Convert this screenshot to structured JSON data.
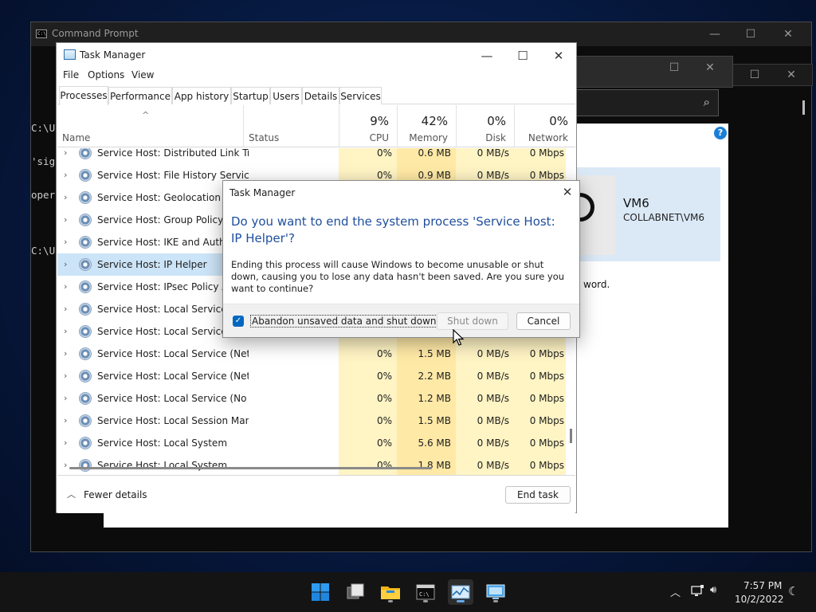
{
  "cmd": {
    "title": "Command Prompt",
    "lines": [
      "C:\\U",
      "'sig",
      "oper",
      "",
      "C:\\U"
    ]
  },
  "settings": {
    "user_name": "VM6",
    "user_account": "COLLABNET\\VM6",
    "text_fragment": "word."
  },
  "task_manager": {
    "title": "Task Manager",
    "menu": [
      "File",
      "Options",
      "View"
    ],
    "tabs": [
      "Processes",
      "Performance",
      "App history",
      "Startup",
      "Users",
      "Details",
      "Services"
    ],
    "columns": {
      "name": "Name",
      "status": "Status",
      "cpu": {
        "pct": "9%",
        "label": "CPU"
      },
      "memory": {
        "pct": "42%",
        "label": "Memory"
      },
      "disk": {
        "pct": "0%",
        "label": "Disk"
      },
      "network": {
        "pct": "0%",
        "label": "Network"
      }
    },
    "rows": [
      {
        "name": "Service Host: Distributed Link Tr...",
        "cpu": "0%",
        "mem": "0.6 MB",
        "disk": "0 MB/s",
        "net": "0 Mbps"
      },
      {
        "name": "Service Host: File History Service",
        "cpu": "0%",
        "mem": "0.9 MB",
        "disk": "0 MB/s",
        "net": "0 Mbps"
      },
      {
        "name": "Service Host: Geolocation Service",
        "cpu": "",
        "mem": "",
        "disk": "",
        "net": ""
      },
      {
        "name": "Service Host: Group Policy Client",
        "cpu": "",
        "mem": "",
        "disk": "",
        "net": ""
      },
      {
        "name": "Service Host: IKE and AuthIP IPsec",
        "cpu": "",
        "mem": "",
        "disk": "",
        "net": ""
      },
      {
        "name": "Service Host: IP Helper",
        "cpu": "",
        "mem": "",
        "disk": "",
        "net": ""
      },
      {
        "name": "Service Host: IPsec Policy Agent",
        "cpu": "",
        "mem": "",
        "disk": "",
        "net": ""
      },
      {
        "name": "Service Host: Local Service (Ne",
        "cpu": "",
        "mem": "",
        "disk": "",
        "net": ""
      },
      {
        "name": "Service Host: Local Service (Ne",
        "cpu": "",
        "mem": "",
        "disk": "",
        "net": ""
      },
      {
        "name": "Service Host: Local Service (Net...",
        "cpu": "0%",
        "mem": "1.5 MB",
        "disk": "0 MB/s",
        "net": "0 Mbps"
      },
      {
        "name": "Service Host: Local Service (Net...",
        "cpu": "0%",
        "mem": "2.2 MB",
        "disk": "0 MB/s",
        "net": "0 Mbps"
      },
      {
        "name": "Service Host: Local Service (No ...",
        "cpu": "0%",
        "mem": "1.2 MB",
        "disk": "0 MB/s",
        "net": "0 Mbps"
      },
      {
        "name": "Service Host: Local Session Man...",
        "cpu": "0%",
        "mem": "1.5 MB",
        "disk": "0 MB/s",
        "net": "0 Mbps"
      },
      {
        "name": "Service Host: Local System",
        "cpu": "0%",
        "mem": "5.6 MB",
        "disk": "0 MB/s",
        "net": "0 Mbps"
      },
      {
        "name": "Service Host: Local System",
        "cpu": "0%",
        "mem": "1.8 MB",
        "disk": "0 MB/s",
        "net": "0 Mbps"
      }
    ],
    "selected_row": 5,
    "fewer_details": "Fewer details",
    "end_task": "End task"
  },
  "dialog": {
    "title": "Task Manager",
    "heading": "Do you want to end the system process 'Service Host: IP Helper'?",
    "body": "Ending this process will cause Windows to become unusable or shut down, causing you to lose any data hasn't been saved. Are you sure you want to continue?",
    "checkbox_label": "Abandon unsaved data and shut down.",
    "checkbox_checked": true,
    "shutdown_button": "Shut down",
    "cancel_button": "Cancel"
  },
  "taskbar": {
    "time": "7:57 PM",
    "date": "10/2/2022"
  },
  "colors": {
    "accent": "#0067c0",
    "selection": "#cce4f7",
    "cpu_heat": "#fff4c4",
    "memory_heat": "#ffe9a6"
  }
}
